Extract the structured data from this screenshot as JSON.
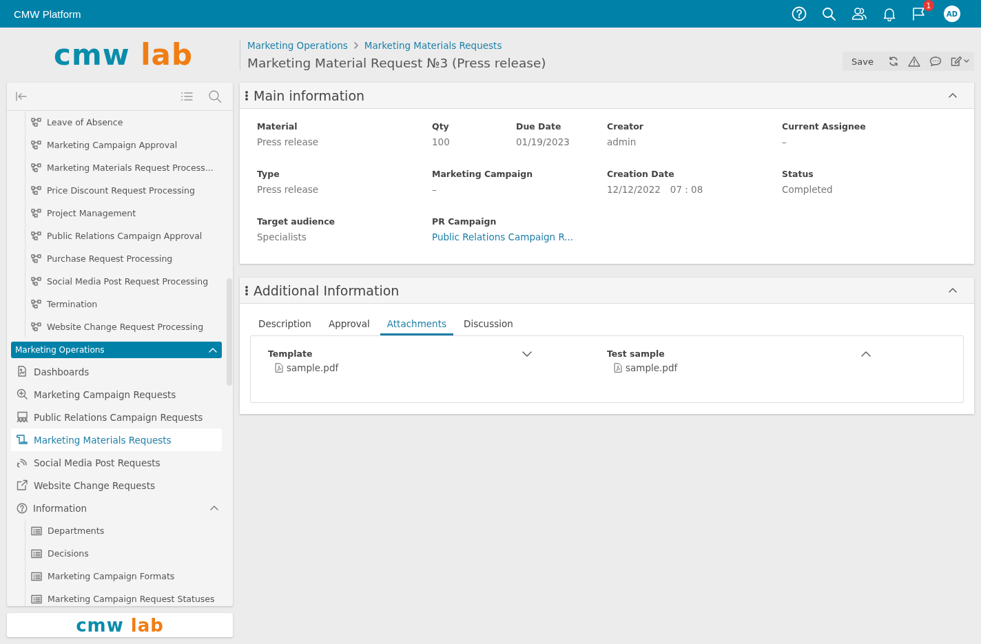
{
  "app_bar": {
    "title": "CMW Platform",
    "notification_count": "1",
    "avatar": "AD"
  },
  "logo": {
    "left": "cmw",
    "right": "lab"
  },
  "sidebar": {
    "items": [
      {
        "kind": "process",
        "label": "Leave of Absence",
        "selected": false
      },
      {
        "kind": "process",
        "label": "Marketing Campaign Approval",
        "selected": false
      },
      {
        "kind": "process",
        "label": "Marketing Materials Request Process...",
        "selected": false
      },
      {
        "kind": "process",
        "label": "Price Discount Request Processing",
        "selected": false
      },
      {
        "kind": "process",
        "label": "Project Management",
        "selected": false
      },
      {
        "kind": "process",
        "label": "Public Relations Campaign Approval",
        "selected": false
      },
      {
        "kind": "process",
        "label": "Purchase Request Processing",
        "selected": false
      },
      {
        "kind": "process",
        "label": "Social Media Post Request Processing",
        "selected": false
      },
      {
        "kind": "process",
        "label": "Termination",
        "selected": false
      },
      {
        "kind": "process",
        "label": "Website Change Request Processing",
        "selected": false
      },
      {
        "kind": "section",
        "label": "Marketing Operations",
        "expanded": true,
        "selected": false
      },
      {
        "kind": "page",
        "label": "Dashboards",
        "selected": false
      },
      {
        "kind": "page",
        "label": "Marketing Campaign Requests",
        "selected": false
      },
      {
        "kind": "page",
        "label": "Public Relations Campaign Requests",
        "selected": false
      },
      {
        "kind": "page",
        "label": "Marketing Materials Requests",
        "selected": true
      },
      {
        "kind": "page",
        "label": "Social Media Post Requests",
        "selected": false
      },
      {
        "kind": "page",
        "label": "Website Change Requests",
        "selected": false
      },
      {
        "kind": "folder",
        "label": "Information",
        "expanded": true,
        "selected": false
      },
      {
        "kind": "table",
        "label": "Departments",
        "selected": false
      },
      {
        "kind": "table",
        "label": "Decisions",
        "selected": false
      },
      {
        "kind": "table",
        "label": "Marketing Campaign Formats",
        "selected": false
      },
      {
        "kind": "table",
        "label": "Marketing Campaign Request Statuses",
        "selected": false
      }
    ]
  },
  "footer_logo": {
    "left": "cmw",
    "right": "lab"
  },
  "breadcrumbs": [
    "Marketing Operations",
    "Marketing Materials Requests"
  ],
  "page_title": "Marketing Material Request №3 (Press release)",
  "toolbar": {
    "save": "Save"
  },
  "main_panel": {
    "title": "Main information",
    "expanded": true,
    "rows": [
      [
        {
          "label": "Material",
          "value": "Press release",
          "kind": "text"
        },
        {
          "label": "Qty",
          "value": "100",
          "kind": "text"
        },
        {
          "label": "Due Date",
          "value": "01/19/2023",
          "kind": "text"
        },
        {
          "label": "Creator",
          "value": "admin",
          "kind": "text"
        },
        {
          "label": "Current Assignee",
          "value": "–",
          "kind": "text"
        }
      ],
      [
        {
          "label": "Type",
          "value": "Press release",
          "kind": "text"
        },
        {
          "label": "Marketing Campaign",
          "value": "–",
          "kind": "text"
        },
        null,
        {
          "label": "Creation Date",
          "value": "12/12/2022",
          "time": "07 : 08",
          "kind": "datetime"
        },
        {
          "label": "Status",
          "value": "Completed",
          "kind": "text"
        }
      ],
      [
        {
          "label": "Target audience",
          "value": "Specialists",
          "kind": "text"
        },
        {
          "label": "PR Campaign",
          "value": "Public Relations Campaign R...",
          "kind": "link"
        }
      ]
    ]
  },
  "additional_panel": {
    "title": "Additional Information",
    "expanded": true,
    "tabs": [
      {
        "label": "Description",
        "selected": false
      },
      {
        "label": "Approval",
        "selected": false
      },
      {
        "label": "Attachments",
        "selected": true
      },
      {
        "label": "Discussion",
        "selected": false
      }
    ],
    "attachments": [
      {
        "title": "Template",
        "expanded": false,
        "files": [
          "sample.pdf"
        ]
      },
      {
        "title": "Test sample",
        "expanded": true,
        "files": [
          "sample.pdf"
        ]
      }
    ]
  }
}
